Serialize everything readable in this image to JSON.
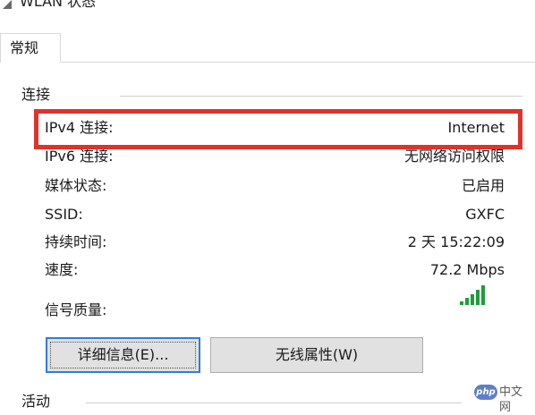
{
  "window": {
    "title": "WLAN 状态"
  },
  "tabs": [
    {
      "label": "常规"
    }
  ],
  "connection": {
    "section_label": "连接",
    "rows": [
      {
        "label": "IPv4 连接:",
        "value": "Internet"
      },
      {
        "label": "IPv6 连接:",
        "value": "无网络访问权限"
      },
      {
        "label": "媒体状态:",
        "value": "已启用"
      },
      {
        "label": "SSID:",
        "value": "GXFC"
      },
      {
        "label": "持续时间:",
        "value": "2 天 15:22:09"
      },
      {
        "label": "速度:",
        "value": "72.2 Mbps"
      }
    ],
    "signal_label": "信号质量:",
    "signal_icon": "signal-strength-icon",
    "signal_level": 5,
    "signal_max": 5
  },
  "buttons": {
    "details_label": "详细信息(E)...",
    "wireless_props_label": "无线属性(W)"
  },
  "activity": {
    "section_label": "活动"
  },
  "watermark": {
    "badge": "php",
    "text": "中文网"
  },
  "colors": {
    "highlight": "#e0322b",
    "signal_green": "#1e9e3a",
    "focus_border": "#2f7fd6"
  }
}
